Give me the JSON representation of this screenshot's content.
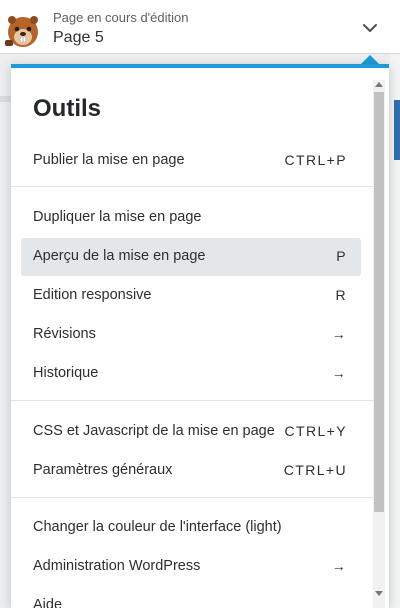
{
  "header": {
    "subtitle": "Page en cours d'édition",
    "title": "Page 5"
  },
  "panel": {
    "title": "Outils",
    "items": [
      {
        "label": "Publier la mise en page",
        "shortcut": "CTRL+P"
      },
      {
        "label": "Dupliquer la mise en page",
        "shortcut": ""
      },
      {
        "label": "Aperçu de la mise en page",
        "shortcut": "P"
      },
      {
        "label": "Edition responsive",
        "shortcut": "R"
      },
      {
        "label": "Révisions",
        "shortcut": "→"
      },
      {
        "label": "Historique",
        "shortcut": "→"
      },
      {
        "label": "CSS et Javascript de la mise en page",
        "shortcut": "CTRL+Y"
      },
      {
        "label": "Paramètres généraux",
        "shortcut": "CTRL+U"
      },
      {
        "label": "Changer la couleur de l'interface (light)",
        "shortcut": ""
      },
      {
        "label": "Administration WordPress",
        "shortcut": "→"
      },
      {
        "label": "Aide",
        "shortcut": ""
      }
    ]
  },
  "colors": {
    "accent": "#1e9bd7",
    "active_item_bg": "#e4e7ea",
    "text": "#2b2f33"
  },
  "icons": {
    "logo": "beaver-logo-icon",
    "chevron": "chevron-down-icon",
    "scroll_up": "scroll-up-arrow-icon",
    "scroll_down": "scroll-down-arrow-icon"
  }
}
